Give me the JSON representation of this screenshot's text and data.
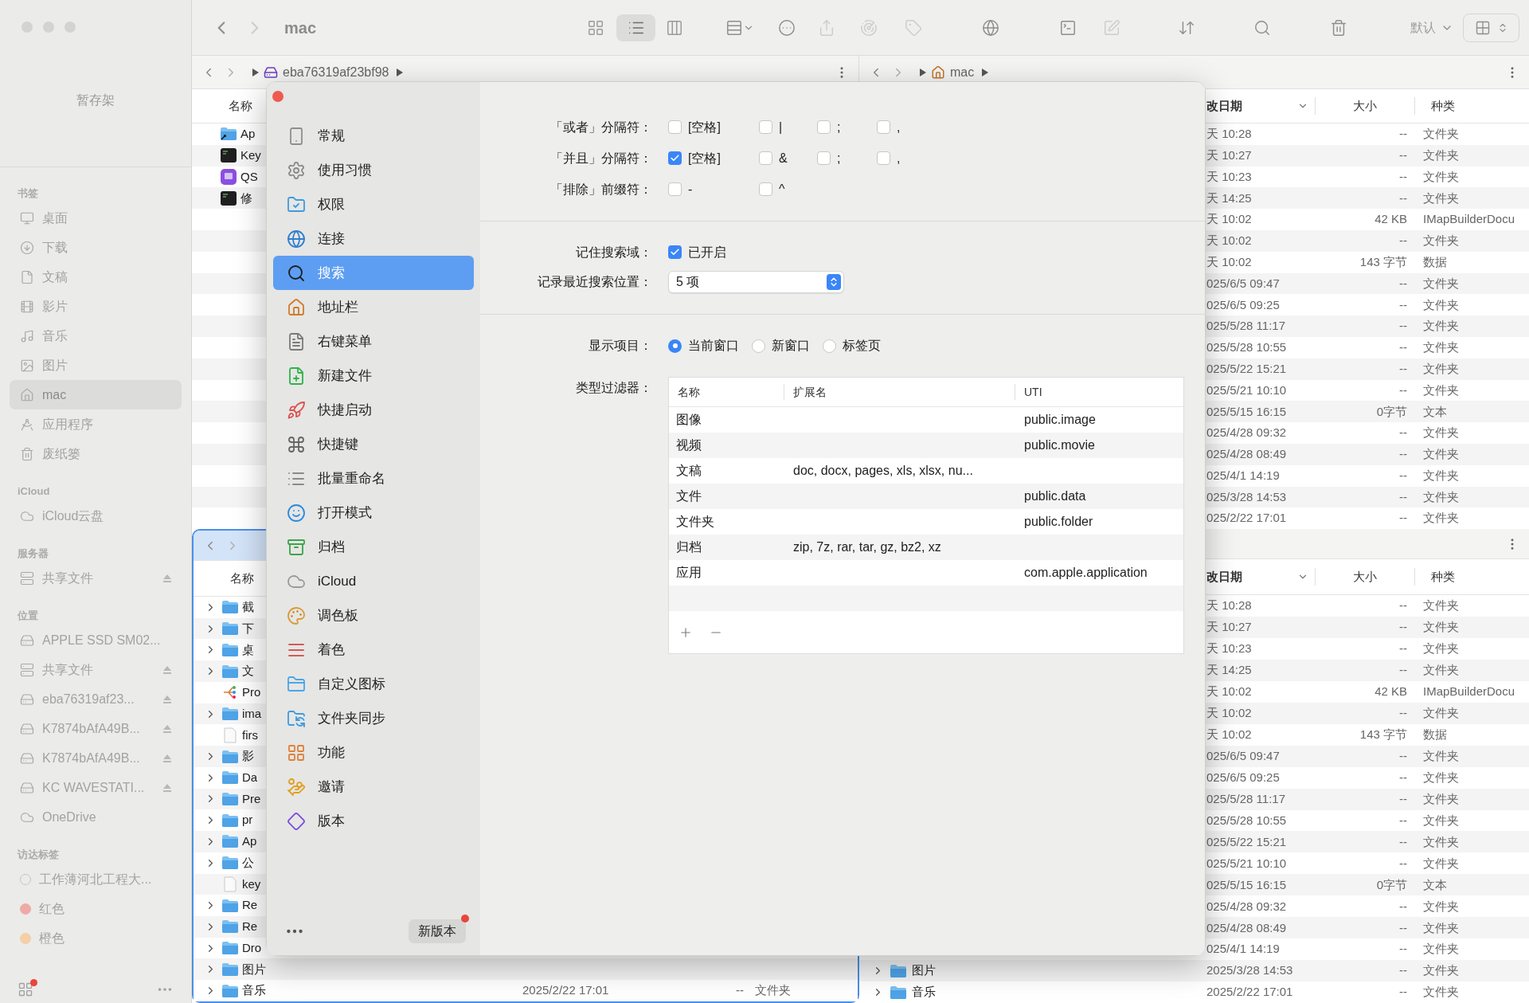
{
  "finder": {
    "sidebar": {
      "shelf": "暂存架",
      "sections": [
        {
          "title": "书签",
          "items": [
            {
              "label": "桌面",
              "selected": false,
              "eject": false
            },
            {
              "label": "下载",
              "selected": false,
              "eject": false
            },
            {
              "label": "文稿",
              "selected": false,
              "eject": false
            },
            {
              "label": "影片",
              "selected": false,
              "eject": false
            },
            {
              "label": "音乐",
              "selected": false,
              "eject": false
            },
            {
              "label": "图片",
              "selected": false,
              "eject": false
            },
            {
              "label": "mac",
              "selected": true,
              "eject": false
            },
            {
              "label": "应用程序",
              "selected": false,
              "eject": false
            },
            {
              "label": "废纸篓",
              "selected": false,
              "eject": false
            }
          ]
        },
        {
          "title": "iCloud",
          "items": [
            {
              "label": "iCloud云盘",
              "selected": false,
              "eject": false
            }
          ]
        },
        {
          "title": "服务器",
          "items": [
            {
              "label": "共享文件",
              "selected": false,
              "eject": true
            }
          ]
        },
        {
          "title": "位置",
          "items": [
            {
              "label": "APPLE SSD SM02...",
              "selected": false,
              "eject": false
            },
            {
              "label": "共享文件",
              "selected": false,
              "eject": true
            },
            {
              "label": "eba76319af23...",
              "selected": false,
              "eject": true
            },
            {
              "label": "K7874bAfA49B...",
              "selected": false,
              "eject": true
            },
            {
              "label": "K7874bAfA49B...",
              "selected": false,
              "eject": true
            },
            {
              "label": "KC WAVESTATI...",
              "selected": false,
              "eject": true
            },
            {
              "label": "OneDrive",
              "selected": false,
              "eject": false
            }
          ]
        },
        {
          "title": "访达标签",
          "items": [
            {
              "label": "工作薄河北工程大...",
              "selected": false,
              "eject": false,
              "color": "#c4c4c4",
              "hollow": true
            },
            {
              "label": "红色",
              "selected": false,
              "eject": false,
              "color": "#f0aaa6",
              "hollow": false
            },
            {
              "label": "橙色",
              "selected": false,
              "eject": false,
              "color": "#f5cfa5",
              "hollow": false
            }
          ]
        }
      ],
      "footer": {
        "badge": true
      }
    },
    "toolbar": {
      "title": "mac",
      "nav": [
        {
          "disabled": false
        },
        {
          "disabled": true
        }
      ],
      "view_modes": [
        {
          "selected": false
        },
        {
          "selected": true
        },
        {
          "selected": false
        }
      ],
      "actions": [
        {
          "disabled": false
        },
        {
          "disabled": false
        },
        {
          "disabled": true
        },
        {
          "disabled": true
        },
        {
          "disabled": true
        },
        {
          "disabled": false
        },
        {
          "disabled": false
        },
        {
          "disabled": true
        },
        {
          "disabled": false
        },
        {
          "disabled": false
        },
        {
          "disabled": false
        }
      ],
      "sort": "默认"
    },
    "panes": {
      "top_left": {
        "active": false,
        "nav": true,
        "path": "eba76319af23bf98",
        "header": {
          "name": "名称"
        },
        "rows": [
          {
            "name": "Ap",
            "kind": "alias"
          },
          {
            "name": "Key",
            "kind": "terminal"
          },
          {
            "name": "QS",
            "kind": "app"
          },
          {
            "name": "修",
            "kind": "terminal"
          }
        ]
      },
      "top_right": {
        "active": false,
        "nav": true,
        "path": "mac",
        "header": {
          "date": "改日期",
          "size": "大小",
          "type": "种类"
        },
        "rows": [
          {
            "date": "天 10:28",
            "size": "--",
            "type": "文件夹"
          },
          {
            "date": "天 10:27",
            "size": "--",
            "type": "文件夹"
          },
          {
            "date": "天 10:23",
            "size": "--",
            "type": "文件夹"
          },
          {
            "date": "天 14:25",
            "size": "--",
            "type": "文件夹"
          },
          {
            "date": "天 10:02",
            "size": "42 KB",
            "type": "IMapBuilderDocu"
          },
          {
            "date": "天 10:02",
            "size": "--",
            "type": "文件夹"
          },
          {
            "date": "天 10:02",
            "size": "143 字节",
            "type": "数据"
          },
          {
            "date": "025/6/5 09:47",
            "size": "--",
            "type": "文件夹"
          },
          {
            "date": "025/6/5 09:25",
            "size": "--",
            "type": "文件夹"
          },
          {
            "date": "025/5/28 11:17",
            "size": "--",
            "type": "文件夹"
          },
          {
            "date": "025/5/28 10:55",
            "size": "--",
            "type": "文件夹"
          },
          {
            "date": "025/5/22 15:21",
            "size": "--",
            "type": "文件夹"
          },
          {
            "date": "025/5/21 10:10",
            "size": "--",
            "type": "文件夹"
          },
          {
            "date": "025/5/15 16:15",
            "size": "0字节",
            "type": "文本"
          },
          {
            "date": "025/4/28 09:32",
            "size": "--",
            "type": "文件夹"
          },
          {
            "date": "025/4/28 08:49",
            "size": "--",
            "type": "文件夹"
          },
          {
            "date": "025/4/1 14:19",
            "size": "--",
            "type": "文件夹"
          },
          {
            "date": "025/3/28 14:53",
            "size": "--",
            "type": "文件夹"
          },
          {
            "date": "025/2/22 17:01",
            "size": "--",
            "type": "文件夹"
          }
        ]
      },
      "bottom_left": {
        "active": true,
        "nav": true,
        "header": {
          "name": "名称"
        },
        "rows": [
          {
            "name": "截",
            "kind": "folder"
          },
          {
            "name": "下",
            "kind": "folder"
          },
          {
            "name": "桌",
            "kind": "folder"
          },
          {
            "name": "文",
            "kind": "folder"
          },
          {
            "name": "Pro",
            "kind": "mindmap"
          },
          {
            "name": "ima",
            "kind": "folder"
          },
          {
            "name": "firs",
            "kind": "document"
          },
          {
            "name": "影",
            "kind": "folder"
          },
          {
            "name": "Da",
            "kind": "folder"
          },
          {
            "name": "Pre",
            "kind": "folder"
          },
          {
            "name": "pr",
            "kind": "folder"
          },
          {
            "name": "Ap",
            "kind": "folder"
          },
          {
            "name": "公",
            "kind": "folder"
          },
          {
            "name": "key",
            "kind": "document"
          },
          {
            "name": "Re",
            "kind": "folder"
          },
          {
            "name": "Re",
            "kind": "folder"
          },
          {
            "name": "Dro",
            "kind": "folder"
          },
          {
            "name": "图片",
            "kind": "folder"
          },
          {
            "name": "音乐",
            "kind": "folder",
            "date": "2025/2/22 17:01",
            "size": "--",
            "type": "文件夹"
          }
        ]
      },
      "bottom_right": {
        "active": false,
        "header": {
          "date": "改日期",
          "size": "大小",
          "type": "种类"
        },
        "rows": [
          {
            "date": "天 10:28",
            "size": "--",
            "type": "文件夹"
          },
          {
            "date": "天 10:27",
            "size": "--",
            "type": "文件夹"
          },
          {
            "date": "天 10:23",
            "size": "--",
            "type": "文件夹"
          },
          {
            "date": "天 14:25",
            "size": "--",
            "type": "文件夹"
          },
          {
            "date": "天 10:02",
            "size": "42 KB",
            "type": "IMapBuilderDocu"
          },
          {
            "date": "天 10:02",
            "size": "--",
            "type": "文件夹"
          },
          {
            "date": "天 10:02",
            "size": "143 字节",
            "type": "数据"
          },
          {
            "date": "025/6/5 09:47",
            "size": "--",
            "type": "文件夹"
          },
          {
            "date": "025/6/5 09:25",
            "size": "--",
            "type": "文件夹"
          },
          {
            "date": "025/5/28 11:17",
            "size": "--",
            "type": "文件夹"
          },
          {
            "date": "025/5/28 10:55",
            "size": "--",
            "type": "文件夹"
          },
          {
            "date": "025/5/22 15:21",
            "size": "--",
            "type": "文件夹"
          },
          {
            "date": "025/5/21 10:10",
            "size": "--",
            "type": "文件夹"
          },
          {
            "date": "025/5/15 16:15",
            "size": "0字节",
            "type": "文本"
          },
          {
            "date": "025/4/28 09:32",
            "size": "--",
            "type": "文件夹"
          },
          {
            "date": "025/4/28 08:49",
            "size": "--",
            "type": "文件夹"
          },
          {
            "date": "025/4/1 14:19",
            "size": "--",
            "type": "文件夹"
          },
          {
            "name": "图片",
            "kind": "folder",
            "date": "2025/3/28 14:53",
            "size": "--",
            "type": "文件夹"
          },
          {
            "name": "音乐",
            "kind": "folder",
            "date": "2025/2/22 17:01",
            "size": "--",
            "type": "文件夹"
          }
        ]
      }
    }
  },
  "preferences": {
    "categories": [
      {
        "label": "常规",
        "selected": false
      },
      {
        "label": "使用习惯",
        "selected": false
      },
      {
        "label": "权限",
        "selected": false
      },
      {
        "label": "连接",
        "selected": false
      },
      {
        "label": "搜索",
        "selected": true
      },
      {
        "label": "地址栏",
        "selected": false
      },
      {
        "label": "右键菜单",
        "selected": false
      },
      {
        "label": "新建文件",
        "selected": false
      },
      {
        "label": "快捷启动",
        "selected": false
      },
      {
        "label": "快捷键",
        "selected": false
      },
      {
        "label": "批量重命名",
        "selected": false
      },
      {
        "label": "打开模式",
        "selected": false
      },
      {
        "label": "归档",
        "selected": false
      },
      {
        "label": "iCloud",
        "selected": false
      },
      {
        "label": "调色板",
        "selected": false
      },
      {
        "label": "着色",
        "selected": false
      },
      {
        "label": "自定义图标",
        "selected": false
      },
      {
        "label": "文件夹同步",
        "selected": false
      },
      {
        "label": "功能",
        "selected": false
      },
      {
        "label": "邀请",
        "selected": false
      },
      {
        "label": "版本",
        "selected": false
      }
    ],
    "update": {
      "label": "新版本",
      "badge": true
    },
    "separators": [
      {
        "label": "「或者」分隔符：",
        "options": [
          {
            "label": "[空格]",
            "checked": false
          },
          {
            "label": "|",
            "checked": false
          },
          {
            "label": ";",
            "checked": false
          },
          {
            "label": ",",
            "checked": false
          }
        ]
      },
      {
        "label": "「并且」分隔符：",
        "options": [
          {
            "label": "[空格]",
            "checked": true
          },
          {
            "label": "&",
            "checked": false
          },
          {
            "label": ";",
            "checked": false
          },
          {
            "label": ",",
            "checked": false
          }
        ]
      },
      {
        "label": "「排除」前缀符：",
        "options": [
          {
            "label": "-",
            "checked": false
          },
          {
            "label": "^",
            "checked": false
          }
        ]
      }
    ],
    "remember_scope": {
      "label": "记住搜索域：",
      "option": "已开启",
      "checked": true
    },
    "recent_locations": {
      "label": "记录最近搜索位置：",
      "value": "5 项"
    },
    "open_in": {
      "label": "显示项目：",
      "options": [
        {
          "label": "当前窗口",
          "selected": true
        },
        {
          "label": "新窗口",
          "selected": false
        },
        {
          "label": "标签页",
          "selected": false
        }
      ]
    },
    "type_filter": {
      "label": "类型过滤器：",
      "columns": [
        "名称",
        "扩展名",
        "UTI"
      ],
      "rows": [
        {
          "name": "图像",
          "uti": "public.image"
        },
        {
          "name": "视频",
          "uti": "public.movie"
        },
        {
          "name": "文稿",
          "extensions": "doc, docx, pages, xls, xlsx, nu..."
        },
        {
          "name": "文件",
          "uti": "public.data"
        },
        {
          "name": "文件夹",
          "uti": "public.folder"
        },
        {
          "name": "归档",
          "extensions": "zip, 7z, rar, tar, gz, bz2, xz"
        },
        {
          "name": "应用",
          "uti": "com.apple.application"
        }
      ]
    }
  }
}
